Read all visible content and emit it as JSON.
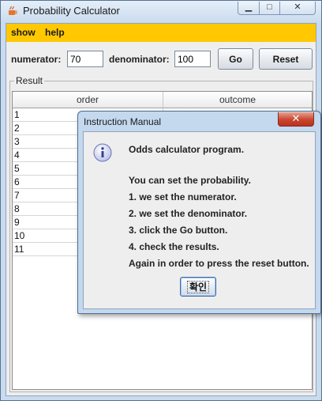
{
  "window": {
    "title": "Probability Calculator",
    "minimize_glyph": "▁",
    "maximize_glyph": "□",
    "close_glyph": "✕"
  },
  "menu": {
    "show": "show",
    "help": "help"
  },
  "inputs": {
    "numerator_label": "numerator:",
    "numerator_value": "70",
    "denominator_label": "denominator:",
    "denominator_value": "100",
    "go_label": "Go",
    "reset_label": "Reset"
  },
  "result": {
    "title": "Result",
    "columns": [
      "order",
      "outcome"
    ],
    "rows": [
      {
        "order": "1"
      },
      {
        "order": "2"
      },
      {
        "order": "3"
      },
      {
        "order": "4"
      },
      {
        "order": "5"
      },
      {
        "order": "6"
      },
      {
        "order": "7"
      },
      {
        "order": "8"
      },
      {
        "order": "9"
      },
      {
        "order": "10"
      },
      {
        "order": "11"
      }
    ]
  },
  "dialog": {
    "title": "Instruction Manual",
    "close_glyph": "✕",
    "icon": "info-icon",
    "lines": [
      "Odds calculator program.",
      "You can set the probability.",
      "1. we set the numerator.",
      "2. we set the denominator.",
      "3. click the Go button.",
      "4. check the results.",
      "Again in order to press the reset button."
    ],
    "ok_label": "확인"
  },
  "colors": {
    "menubar": "#ffc800",
    "window_frame": "#c9dbee",
    "dialog_close": "#c9452f"
  }
}
